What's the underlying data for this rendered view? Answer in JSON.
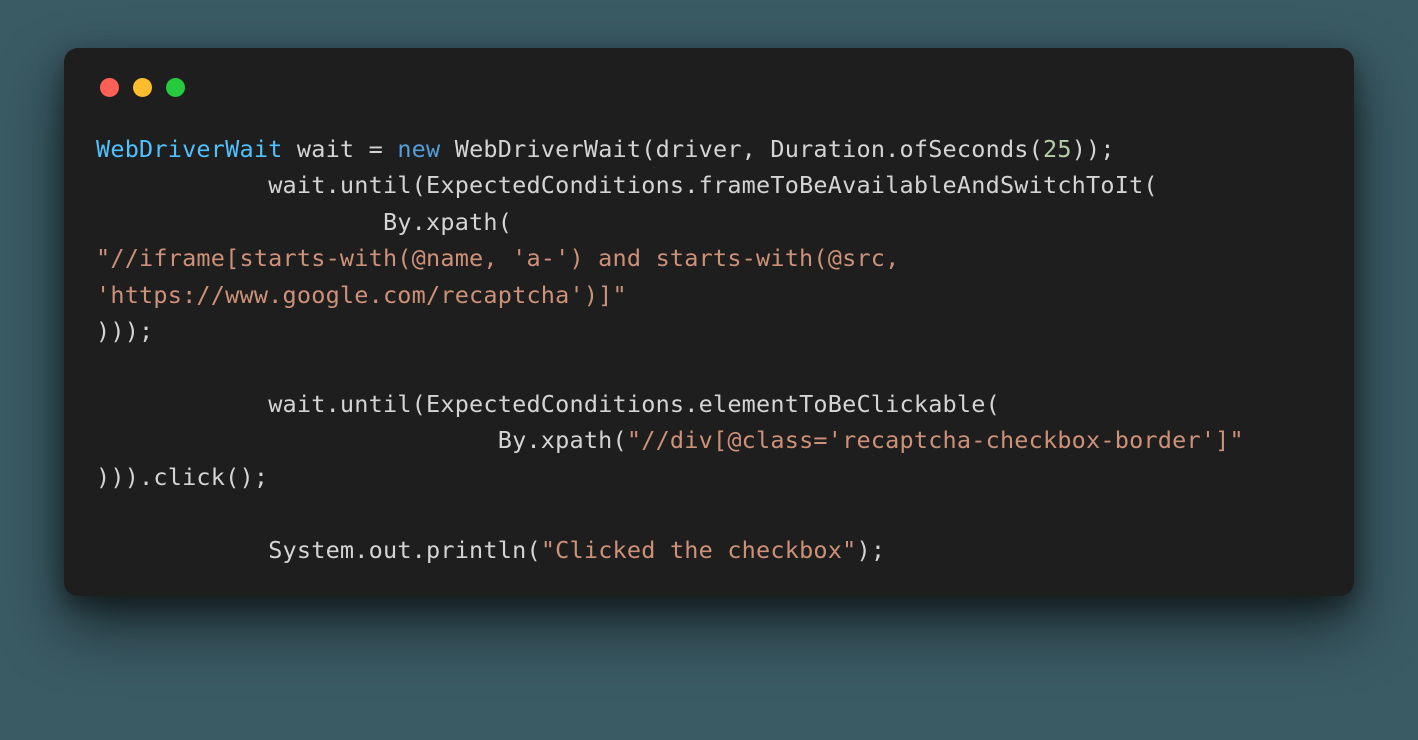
{
  "window": {
    "dots": [
      "red",
      "yellow",
      "green"
    ]
  },
  "code": {
    "t1": "WebDriverWait",
    "t2": " wait = ",
    "t3": "new",
    "t4": " WebDriverWait(driver, Duration.ofSeconds(",
    "t5": "25",
    "t6": "));\n            wait.until(ExpectedConditions.frameToBeAvailableAndSwitchToIt(\n                    By.xpath(\n",
    "t7": "\"//iframe[starts-with(@name, 'a-') and starts-with(@src, 'https://www.google.com/recaptcha')]\"",
    "t8": "\n)));\n\n            wait.until(ExpectedConditions.elementToBeClickable(\n                            By.xpath(",
    "t9": "\"//div[@class='recaptcha-checkbox-border']\"",
    "t10": "\n))).click();\n\n            System.out.println(",
    "t11": "\"Clicked the checkbox\"",
    "t12": ");"
  }
}
